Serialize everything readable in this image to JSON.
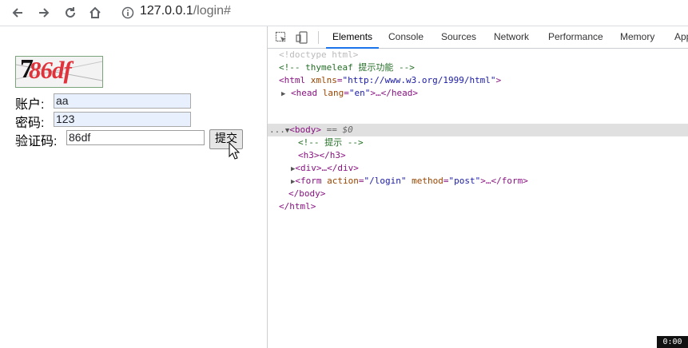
{
  "browser": {
    "url_host": "127.0.0.1",
    "url_path": "/login#",
    "icons": [
      "back-icon",
      "forward-icon",
      "reload-icon",
      "home-icon",
      "info-icon"
    ]
  },
  "page": {
    "captcha_text": "86df",
    "captcha_prefix": "7",
    "account_label": "账户:",
    "account_value": "aa",
    "password_label": "密码:",
    "password_value": "123",
    "code_label": "验证码:",
    "code_value": "86df",
    "submit_label": "提交"
  },
  "devtools": {
    "tabs": [
      "Elements",
      "Console",
      "Sources",
      "Network",
      "Performance",
      "Memory",
      "App"
    ],
    "active_tab": "Elements",
    "lines": {
      "doctype": "<!doctype html>",
      "comment1": "<!-- thymeleaf 提示功能 -->",
      "html_open_tag": "<html ",
      "html_attr": "xmlns",
      "html_val": "\"http://www.w3.org/1999/html\"",
      "head_tag": "<head ",
      "head_attr": "lang",
      "head_val": "\"en\"",
      "head_rest": ">…</head>",
      "body_prefix": "...",
      "body_tag": "<body>",
      "body_eq": " == $0",
      "comment2": "<!-- 提示 -->",
      "h3": "<h3></h3>",
      "div": "<div>…</div>",
      "form_tag": "<form ",
      "form_attr1": "action",
      "form_val1": "\"/login\"",
      "form_attr2": "method",
      "form_val2": "\"post\"",
      "form_rest": ">…</form>",
      "body_close": "</body>",
      "html_close": "</html>"
    }
  },
  "timer": "0:00",
  "colors": {
    "accent": "#1a73e8",
    "captcha": "#e0323a",
    "autofill": "#e8f0fe"
  }
}
